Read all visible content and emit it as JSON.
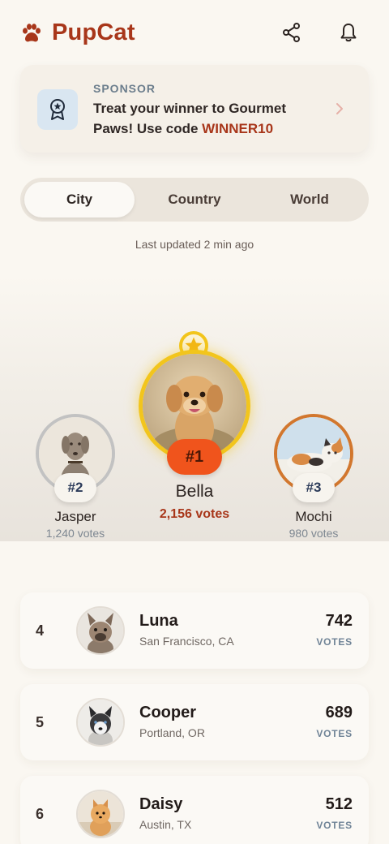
{
  "app": {
    "name": "PupCat"
  },
  "icons": {
    "logo": "paw-icon",
    "share": "share-icon",
    "notifications": "bell-icon",
    "sponsor": "award-ribbon-icon",
    "chevron": "chevron-right-icon",
    "crown": "star-icon"
  },
  "colors": {
    "brand": "#a8361a",
    "first_place": "#f0541c",
    "gold_ring": "#f2c51c",
    "silver_ring": "#c2c2c2",
    "bronze_ring": "#d2772e",
    "background": "#faf7f1"
  },
  "sponsor": {
    "tag": "SPONSOR",
    "text_before": "Treat your winner to Gourmet Paws! Use code ",
    "code": "WINNER10"
  },
  "tabs": [
    {
      "label": "City",
      "active": true
    },
    {
      "label": "Country",
      "active": false
    },
    {
      "label": "World",
      "active": false
    }
  ],
  "last_updated": "Last updated 2 min ago",
  "podium": {
    "first": {
      "rank": "#1",
      "name": "Bella",
      "votes": "2,156 votes"
    },
    "second": {
      "rank": "#2",
      "name": "Jasper",
      "votes": "1,240 votes"
    },
    "third": {
      "rank": "#3",
      "name": "Mochi",
      "votes": "980 votes"
    }
  },
  "leaderboard": [
    {
      "rank": "4",
      "name": "Luna",
      "location": "San Francisco, CA",
      "count": "742",
      "unit": "VOTES"
    },
    {
      "rank": "5",
      "name": "Cooper",
      "location": "Portland, OR",
      "count": "689",
      "unit": "VOTES"
    },
    {
      "rank": "6",
      "name": "Daisy",
      "location": "Austin, TX",
      "count": "512",
      "unit": "VOTES"
    }
  ]
}
